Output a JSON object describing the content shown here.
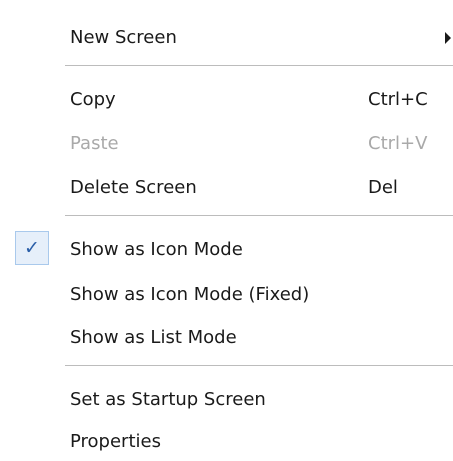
{
  "menu": {
    "items": {
      "new_screen": {
        "label": "New Screen"
      },
      "copy": {
        "label": "Copy",
        "shortcut": "Ctrl+C"
      },
      "paste": {
        "label": "Paste",
        "shortcut": "Ctrl+V",
        "enabled": false
      },
      "delete_screen": {
        "label": "Delete Screen",
        "shortcut": "Del"
      },
      "show_icon_mode": {
        "label": "Show as Icon Mode",
        "checked": true,
        "check_glyph": "✓"
      },
      "show_icon_mode_fixed": {
        "label": "Show as Icon Mode (Fixed)"
      },
      "show_list_mode": {
        "label": "Show as List Mode"
      },
      "set_startup": {
        "label": "Set as Startup Screen"
      },
      "properties": {
        "label": "Properties"
      }
    }
  },
  "icons": {
    "submenu_arrow": "chevron-right-icon",
    "check": "checkmark-icon"
  },
  "colors": {
    "text": "#1a1a1a",
    "disabled_text": "#a9a9a9",
    "separator": "#bcbcbc",
    "check_background": "#e6effa",
    "check_border": "#a9c9ec",
    "check_mark": "#2a5ea8"
  }
}
